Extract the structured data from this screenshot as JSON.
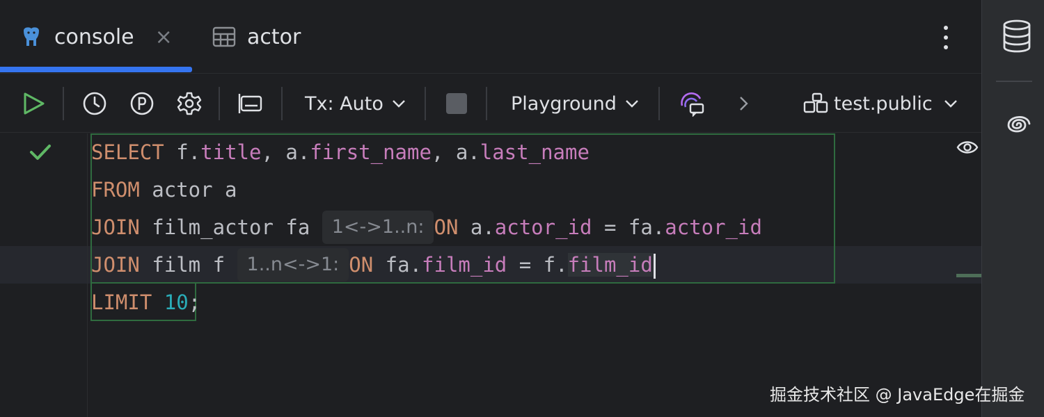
{
  "tabs": [
    {
      "label": "console",
      "icon": "postgresql-elephant-icon",
      "active": true,
      "closable": true
    },
    {
      "label": "actor",
      "icon": "table-icon",
      "active": false
    }
  ],
  "tab_close_glyph": "×",
  "toolbar": {
    "tx_label": "Tx: Auto",
    "playground_label": "Playground",
    "schema_label": "test.public"
  },
  "editor": {
    "lines": [
      {
        "parts": [
          [
            "kw",
            "SELECT"
          ],
          [
            "plain",
            " f."
          ],
          [
            "col",
            "title"
          ],
          [
            "plain",
            ", a."
          ],
          [
            "col",
            "first_name"
          ],
          [
            "plain",
            ", a."
          ],
          [
            "col",
            "last_name"
          ]
        ]
      },
      {
        "parts": [
          [
            "kw",
            "FROM"
          ],
          [
            "plain",
            " actor a"
          ]
        ]
      },
      {
        "parts": [
          [
            "kw",
            "JOIN"
          ],
          [
            "plain",
            " film_actor fa "
          ],
          [
            "hint",
            "1<->1..n:"
          ],
          [
            "kw",
            "ON"
          ],
          [
            "plain",
            " a."
          ],
          [
            "col",
            "actor_id"
          ],
          [
            "plain",
            " = fa."
          ],
          [
            "col",
            "actor_id"
          ]
        ]
      },
      {
        "parts": [
          [
            "kw",
            "JOIN"
          ],
          [
            "plain",
            " film f "
          ],
          [
            "hint",
            "1..n<->1:"
          ],
          [
            "kw",
            "ON"
          ],
          [
            "plain",
            " fa."
          ],
          [
            "col",
            "film_id"
          ],
          [
            "plain",
            " = f."
          ],
          [
            "colhl",
            "film_id"
          ],
          [
            "caret",
            ""
          ]
        ]
      },
      {
        "parts": [
          [
            "kw",
            "LIMIT"
          ],
          [
            "plain",
            " "
          ],
          [
            "num",
            "10"
          ],
          [
            "plain",
            ";"
          ]
        ]
      }
    ],
    "status": "success"
  },
  "watermark": "掘金技术社区 @ JavaEdge在掘金",
  "colors": {
    "accent": "#3574f0",
    "keyword": "#cf8e6d",
    "column": "#c77dbb",
    "number": "#2aacb8",
    "success": "#5fb865",
    "run": "#5fb865"
  }
}
